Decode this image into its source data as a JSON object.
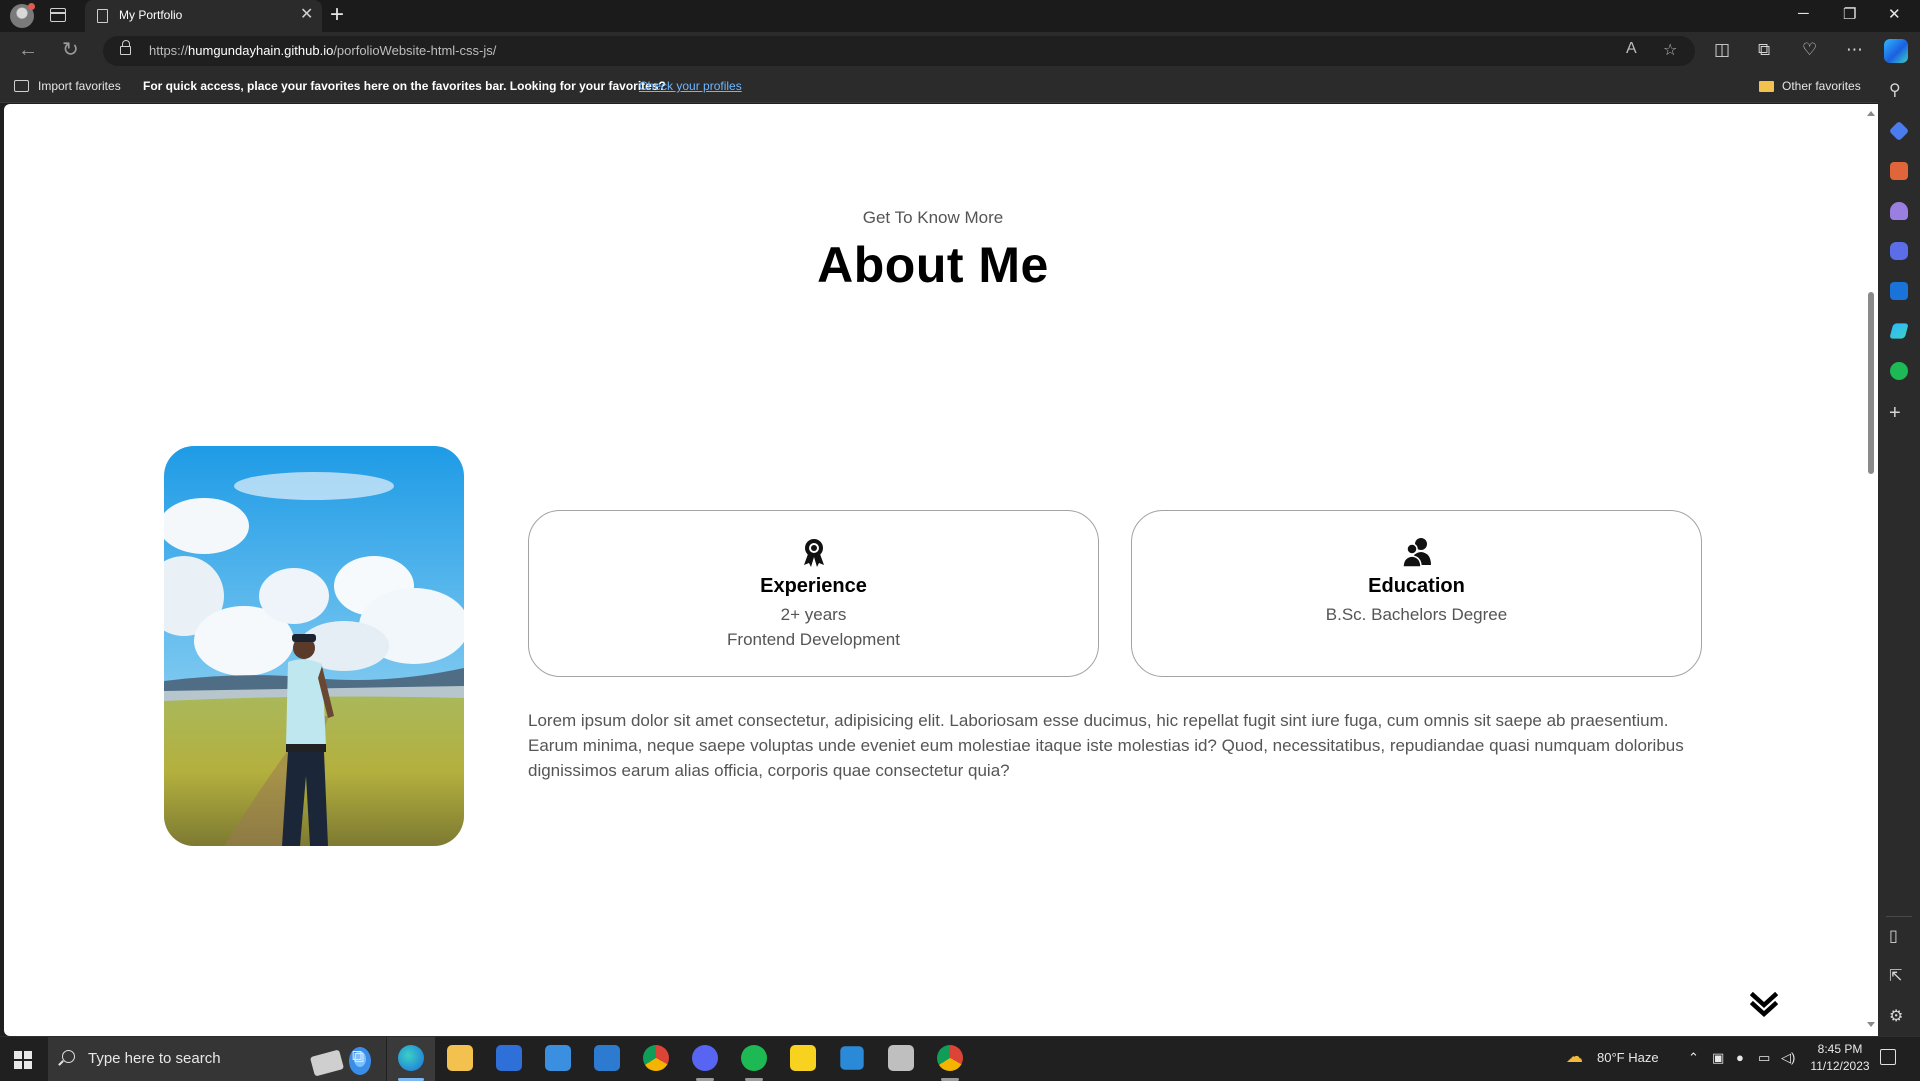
{
  "browser": {
    "tab_title": "My Portfolio",
    "tab_close": "✕",
    "new_tab": "+",
    "url_scheme": "https://",
    "url_host": "humgundayhain.github.io",
    "url_path": "/porfolioWebsite-html-css-js/",
    "favorites_bar": {
      "import_label": "Import favorites",
      "message": "For quick access, place your favorites here on the favorites bar. Looking for your favorites?",
      "link_label": "Check your profiles",
      "other_label": "Other favorites"
    }
  },
  "page": {
    "subtitle": "Get To Know More",
    "title": "About Me",
    "experience": {
      "title": "Experience",
      "line1": "2+ years",
      "line2": "Frontend Development"
    },
    "education": {
      "title": "Education",
      "line1": "B.Sc. Bachelors Degree"
    },
    "paragraph": "Lorem ipsum dolor sit amet consectetur, adipisicing elit. Laboriosam esse ducimus, hic repellat fugit sint iure fuga, cum omnis sit saepe ab praesentium. Earum minima, neque saepe voluptas unde eveniet eum molestiae itaque iste molestias id? Quod, necessitatibus, repudiandae quasi numquam doloribus dignissimos earum alias officia, corporis quae consectetur quia?"
  },
  "taskbar": {
    "search_placeholder": "Type here to search",
    "weather": "80°F  Haze",
    "time": "8:45 PM",
    "date": "11/12/2023"
  },
  "colors": {
    "accent_link": "#6cb6ff",
    "card_border": "#a3a3a3",
    "body_text": "#555555"
  },
  "icons": [
    "profile-icon",
    "tab-actions-icon",
    "page-icon",
    "close-icon",
    "plus-icon",
    "back-icon",
    "refresh-icon",
    "lock-icon",
    "read-aloud-icon",
    "star-icon",
    "split-screen-icon",
    "collections-icon",
    "browser-essentials-icon",
    "more-icon",
    "copilot-icon",
    "award-icon",
    "users-icon",
    "double-chevron-down-icon",
    "windows-start-icon",
    "search-icon",
    "task-view-icon"
  ]
}
